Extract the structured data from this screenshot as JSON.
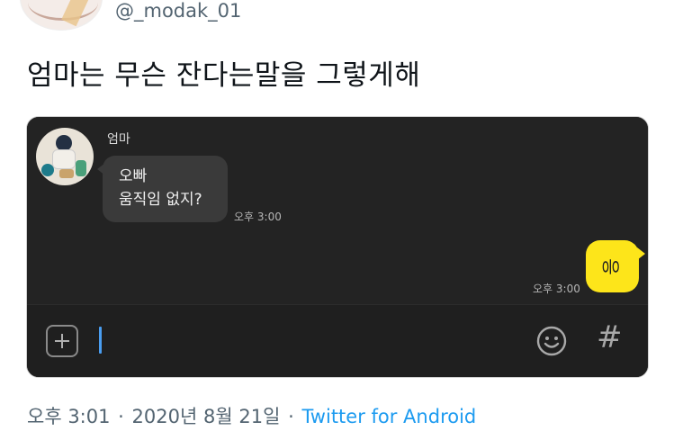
{
  "tweet": {
    "handle": "@_modak_01",
    "text": "엄마는 무슨 잔다는말을 그렇게해"
  },
  "chat": {
    "sender_name": "엄마",
    "incoming_line1": "오빠",
    "incoming_line2": "움직임 없지?",
    "incoming_time": "오후 3:00",
    "outgoing_text": "응",
    "outgoing_time": "오후 3:00",
    "outgoing_bubble_color": "#fde51a",
    "input_icons": [
      "plus-icon",
      "emoji-icon",
      "hash-icon"
    ],
    "hash_symbol": "#"
  },
  "meta": {
    "time": "오후 3:01",
    "date": "2020년 8월 21일",
    "separator": "·",
    "source": "Twitter for Android",
    "source_color": "#1d9bf0"
  }
}
